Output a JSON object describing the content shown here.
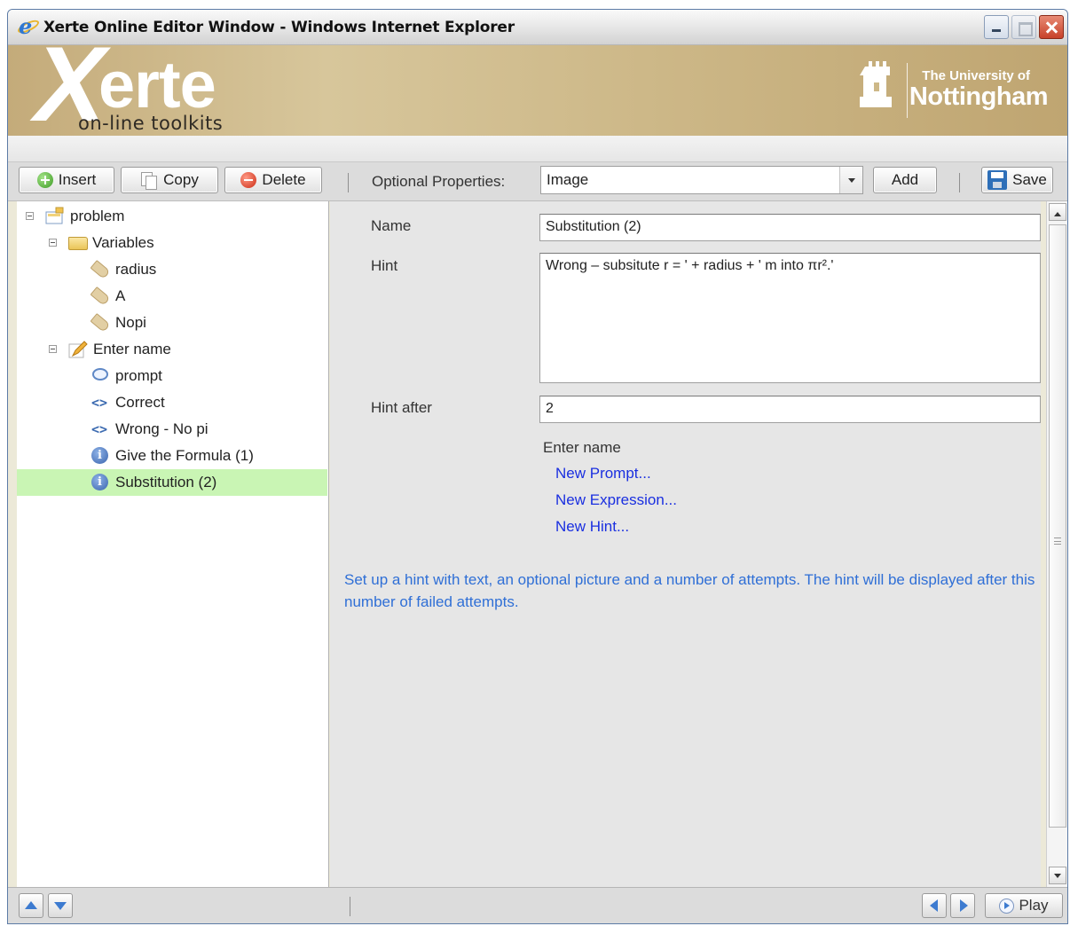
{
  "window": {
    "title": "Xerte Online Editor Window - Windows Internet Explorer"
  },
  "header": {
    "logo_x": "X",
    "logo_rest": "erte",
    "logo_sub": "on-line toolkits",
    "university_small": "The University of",
    "university_big": "Nottingham"
  },
  "toolbar": {
    "insert_label": "Insert",
    "copy_label": "Copy",
    "delete_label": "Delete",
    "optional_properties_label": "Optional Properties:",
    "optional_properties_value": "Image",
    "add_label": "Add",
    "save_label": "Save"
  },
  "tree": {
    "items": [
      {
        "label": "problem",
        "icon": "project-icon",
        "expanded": true
      },
      {
        "label": "Variables",
        "icon": "folder-icon",
        "expanded": true
      },
      {
        "label": "radius",
        "icon": "tag-icon"
      },
      {
        "label": "A",
        "icon": "tag-icon"
      },
      {
        "label": "Nopi",
        "icon": "tag-icon"
      },
      {
        "label": "Enter name",
        "icon": "pencil-icon",
        "expanded": true
      },
      {
        "label": "prompt",
        "icon": "speech-bubble-icon"
      },
      {
        "label": "Correct",
        "icon": "code-icon"
      },
      {
        "label": "Wrong - No pi",
        "icon": "code-icon"
      },
      {
        "label": "Give the Formula (1)",
        "icon": "info-icon"
      },
      {
        "label": "Substitution (2)",
        "icon": "info-icon",
        "selected": true
      }
    ]
  },
  "properties": {
    "name_label": "Name",
    "name_value": "Substitution (2)",
    "hint_label": "Hint",
    "hint_value": "Wrong – subsitute r = ' + radius + ' m into πr².'",
    "hint_after_label": "Hint after",
    "hint_after_value": "2",
    "parent_heading": "Enter name",
    "new_prompt": "New Prompt...",
    "new_expression": "New Expression...",
    "new_hint": "New Hint...",
    "help_text": "Set up a hint with text, an optional picture and a number of attempts. The hint will be displayed after this number of failed attempts."
  },
  "bottombar": {
    "play_label": "Play"
  },
  "colors": {
    "selection": "#c9f5b4",
    "link": "#1a2fe0",
    "help": "#2f6fd6",
    "banner": "#d7c69b"
  }
}
